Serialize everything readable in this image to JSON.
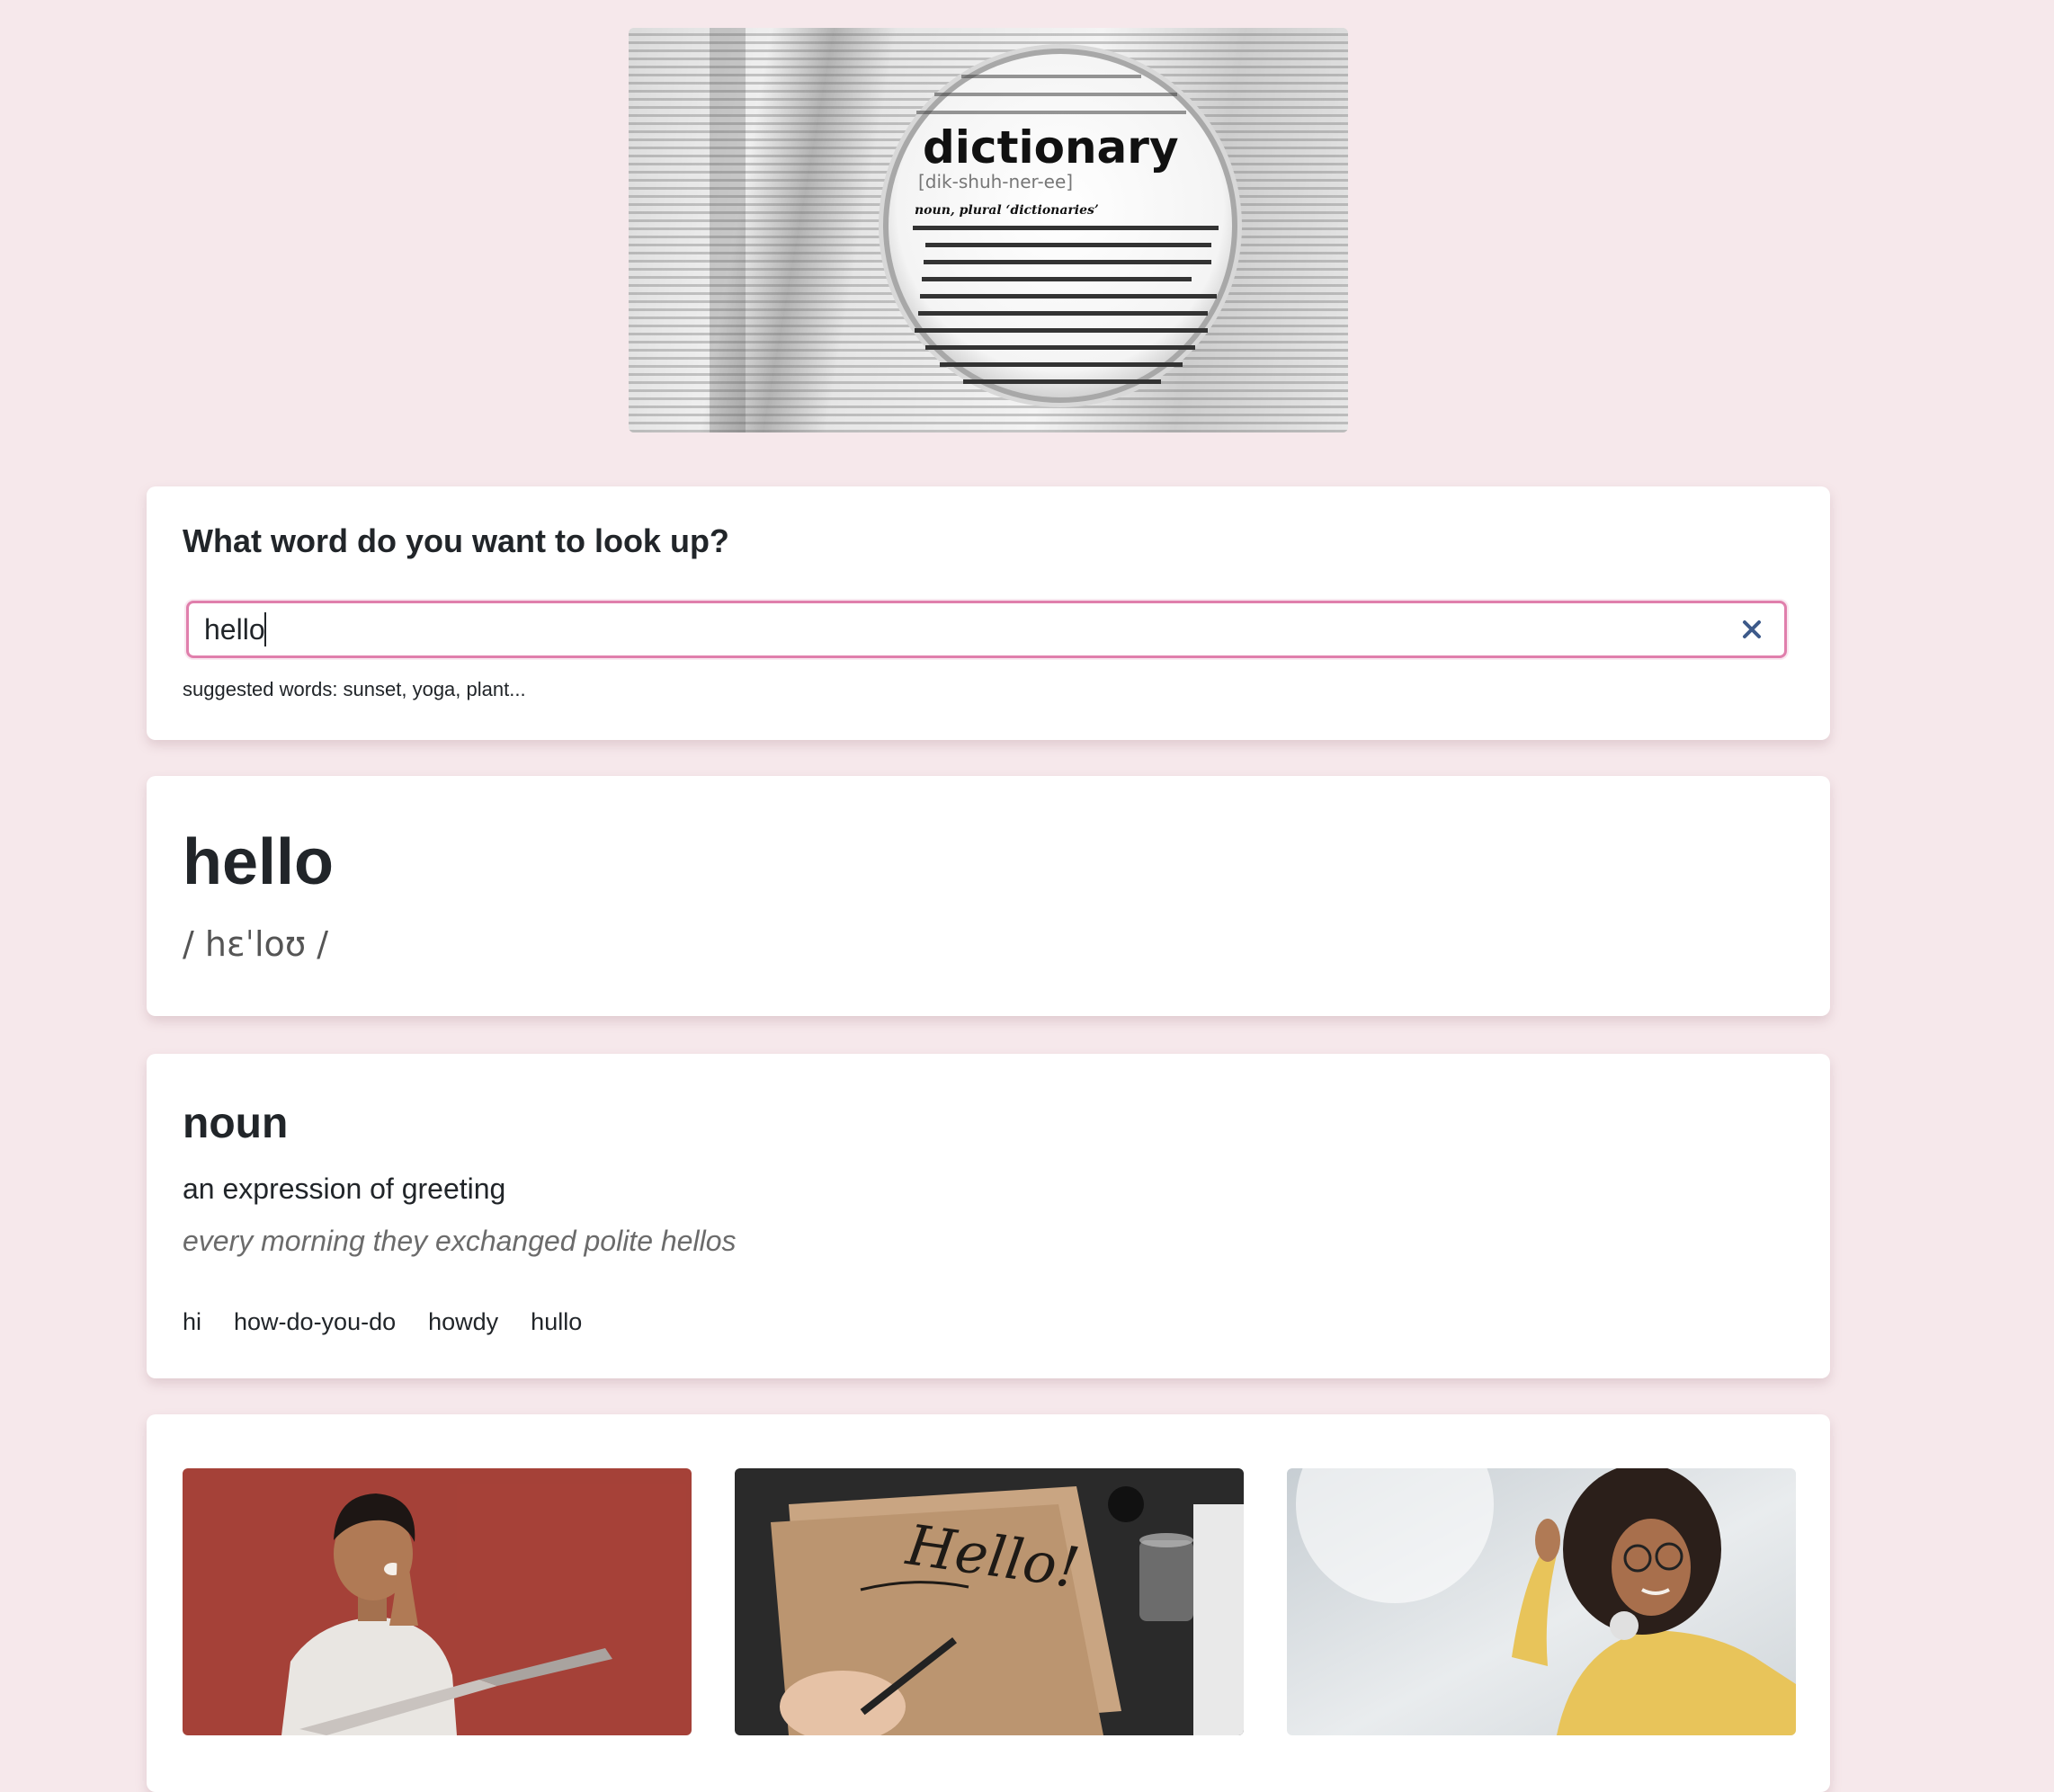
{
  "hero": {
    "image_name": "dictionary-magnifier-image",
    "headword": "dictionary",
    "pronunciation": "[dik-shuh-ner-ee]",
    "pos_line": "noun, plural ‘dictionaries’"
  },
  "search": {
    "prompt": "What word do you want to look up?",
    "value": "hello",
    "clear_icon": "close-icon",
    "suggested": "suggested words: sunset, yoga, plant..."
  },
  "result": {
    "word": "hello",
    "phonetic": "/ hɛˈloʊ /"
  },
  "meaning": {
    "part_of_speech": "noun",
    "definition": "an expression of greeting",
    "example": "every morning they exchanged polite hellos",
    "synonyms": [
      "hi",
      "how-do-you-do",
      "howdy",
      "hullo"
    ]
  },
  "photos": [
    {
      "name": "man-waving-with-laptop-photo",
      "accent": "#b4473d"
    },
    {
      "name": "hello-calligraphy-photo",
      "accent": "#2a2a2a"
    },
    {
      "name": "woman-waving-photo",
      "accent": "#e8c45a"
    }
  ],
  "colors": {
    "background": "#f6e8eb",
    "card": "#ffffff",
    "input_border": "#e07fac",
    "clear_icon": "#3d5a8a"
  }
}
